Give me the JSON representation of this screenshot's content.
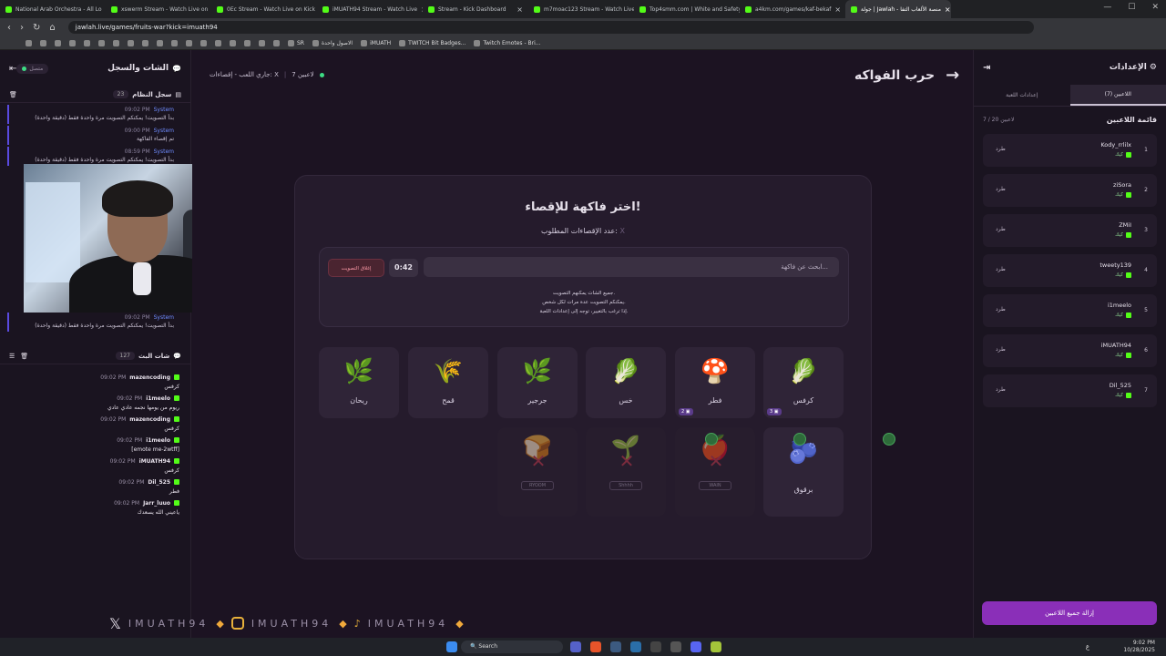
{
  "browser": {
    "tabs": [
      {
        "label": "National Arab Orchestra - All Lo"
      },
      {
        "label": "xswerm Stream - Watch Live on"
      },
      {
        "label": "0Ec Stream - Watch Live on Kick"
      },
      {
        "label": "iMUATH94 Stream - Watch Live"
      },
      {
        "label": "Stream - Kick Dashboard"
      },
      {
        "label": "m7moac123 Stream - Watch Live on"
      },
      {
        "label": "Top4smm.com | White and Safety Pr"
      },
      {
        "label": "a4km.com/games/kaf-bekaf"
      },
      {
        "label": "جولة | Jawlah - منصة الألعاب التفا"
      }
    ],
    "url": "jawlah.live/games/fruits-war?kick=imuath94",
    "bookmarks": [
      "SR",
      "الاصول واحدة",
      "iMUATH",
      "TWITCH Bit Badges...",
      "Twitch Emotes - Bri..."
    ]
  },
  "left_panel": {
    "title": "الشات والسجل",
    "status": "متصل",
    "system_log": {
      "title": "سجل النظام",
      "count": "23",
      "messages": [
        {
          "time": "09:02 PM",
          "sender": "System",
          "text": "بدأ التصويت! يمكنكم التصويت مرة واحدة فقط (دقيقة واحدة)"
        },
        {
          "time": "09:00 PM",
          "sender": "System",
          "text": "تم إقصاء الفاكهة"
        },
        {
          "time": "08:59 PM",
          "sender": "System",
          "text": "بدأ التصويت! يمكنكم التصويت مرة واحدة فقط (دقيقة واحدة)"
        }
      ],
      "last_message": {
        "time": "09:02 PM",
        "sender": "System",
        "text": "بدأ التصويت! يمكنكم التصويت مرة واحدة فقط (دقيقة واحدة)"
      }
    },
    "live_chat": {
      "title": "شات البث",
      "count": "127",
      "messages": [
        {
          "time": "09:02 PM",
          "user": "mazencoding",
          "text": "كرفس"
        },
        {
          "time": "09:02 PM",
          "user": "i1meelo",
          "text": "ريوم من يومها نجمه عادي عادي"
        },
        {
          "time": "09:02 PM",
          "user": "mazencoding",
          "text": "كرفس"
        },
        {
          "time": "09:02 PM",
          "user": "i1meelo",
          "text": "[emote me-2wtff]"
        },
        {
          "time": "09:02 PM",
          "user": "iMUATH94",
          "text": "كرفس"
        },
        {
          "time": "09:02 PM",
          "user": "Dil_525",
          "text": "فطر"
        },
        {
          "time": "09:02 PM",
          "user": "Jarr_luuo",
          "text": "ياعيني الله يسعدك"
        }
      ]
    }
  },
  "main": {
    "top_status": {
      "players": "7 لاعبين",
      "state": "جاري اللعب - إقصاءات: X"
    },
    "game_title": "حرب الفواكه",
    "card": {
      "heading": "اختر فاكهة للإقصاء!",
      "elimination_label": "عدد الإقصاءات المطلوب:",
      "elimination_value": "X",
      "search_placeholder": "ابحث عن فاكهة...",
      "timer": "0:42",
      "close_vote": "إغلاق التصويت",
      "rules": [
        "جميع الشات يمكنهم التصويت.",
        "يمكنكم التصويت عدة مرات لكل شخص.",
        "إذا ترغب بالتغيير، توجه إلى إعدادات اللعبة."
      ]
    },
    "fruits_row1": [
      {
        "name": "كرفس",
        "emoji": "🥬",
        "votes": "3"
      },
      {
        "name": "فطر",
        "emoji": "🍄",
        "votes": "2"
      },
      {
        "name": "خس",
        "emoji": "🥬",
        "votes": ""
      },
      {
        "name": "جرجير",
        "emoji": "🌿",
        "votes": ""
      },
      {
        "name": "قمح",
        "emoji": "🌾",
        "votes": ""
      },
      {
        "name": "ريحان",
        "emoji": "🌿",
        "votes": ""
      }
    ],
    "fruits_row2": [
      {
        "name": "برقوق",
        "emoji": "🫐",
        "status": "active",
        "owner": ""
      },
      {
        "name": "",
        "emoji": "🍎",
        "status": "eliminated",
        "owner": "WAIN"
      },
      {
        "name": "",
        "emoji": "🌱",
        "status": "eliminated",
        "owner": "Shhhh"
      },
      {
        "name": "",
        "emoji": "🍞",
        "status": "eliminated",
        "owner": "RYOOM"
      }
    ]
  },
  "right_panel": {
    "title": "الإعدادات",
    "tabs": [
      "اللاعبين (7)",
      "إعدادات اللعبة"
    ],
    "players_title": "قائمة اللاعبين",
    "players_count": "7 / 20 لاعبين",
    "kick_label": "طرد",
    "platform": "كيك",
    "players": [
      {
        "num": "1",
        "name": "Kody_rrlilx"
      },
      {
        "num": "2",
        "name": "ziSora"
      },
      {
        "num": "3",
        "name": "ZMiI"
      },
      {
        "num": "4",
        "name": "tweety139"
      },
      {
        "num": "5",
        "name": "i1meelo"
      },
      {
        "num": "6",
        "name": "iMUATH94"
      },
      {
        "num": "7",
        "name": "Dil_525"
      }
    ],
    "remove_all": "إزالة جميع اللاعبين"
  },
  "overlay_strip": {
    "handle": "IMUATH94"
  },
  "taskbar": {
    "search": "Search",
    "time": "9:02 PM",
    "date": "10/28/2025",
    "lang": "ع"
  }
}
